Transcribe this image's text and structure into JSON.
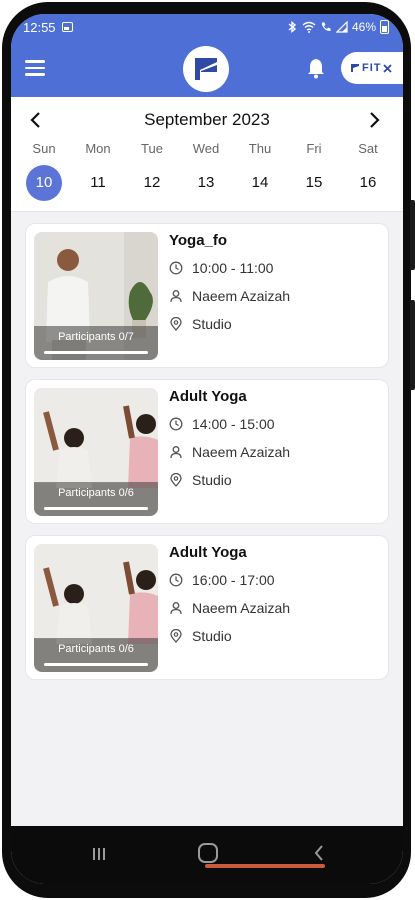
{
  "status_bar": {
    "time": "12:55",
    "battery": "46%"
  },
  "header": {
    "brand_text": "FIT",
    "menu_icon": "hamburger-icon",
    "notification_icon": "bell-icon",
    "accent_color": "#4e6fd6"
  },
  "calendar": {
    "month_title": "September 2023",
    "prev_icon": "chevron-left-icon",
    "next_icon": "chevron-right-icon",
    "days": [
      {
        "name": "Sun",
        "date": "10",
        "selected": true
      },
      {
        "name": "Mon",
        "date": "11",
        "selected": false
      },
      {
        "name": "Tue",
        "date": "12",
        "selected": false
      },
      {
        "name": "Wed",
        "date": "13",
        "selected": false
      },
      {
        "name": "Thu",
        "date": "14",
        "selected": false
      },
      {
        "name": "Fri",
        "date": "15",
        "selected": false
      },
      {
        "name": "Sat",
        "date": "16",
        "selected": false
      }
    ]
  },
  "classes": [
    {
      "name": "Yoga_fo",
      "time": "10:00 - 11:00",
      "instructor": "Naeem Azaizah",
      "location": "Studio",
      "participants": "Participants 0/7",
      "fill_fraction": 0
    },
    {
      "name": "Adult Yoga",
      "time": "14:00 - 15:00",
      "instructor": "Naeem Azaizah",
      "location": "Studio",
      "participants": "Participants 0/6",
      "fill_fraction": 0
    },
    {
      "name": "Adult Yoga",
      "time": "16:00 - 17:00",
      "instructor": "Naeem Azaizah",
      "location": "Studio",
      "participants": "Participants 0/6",
      "fill_fraction": 0
    }
  ]
}
